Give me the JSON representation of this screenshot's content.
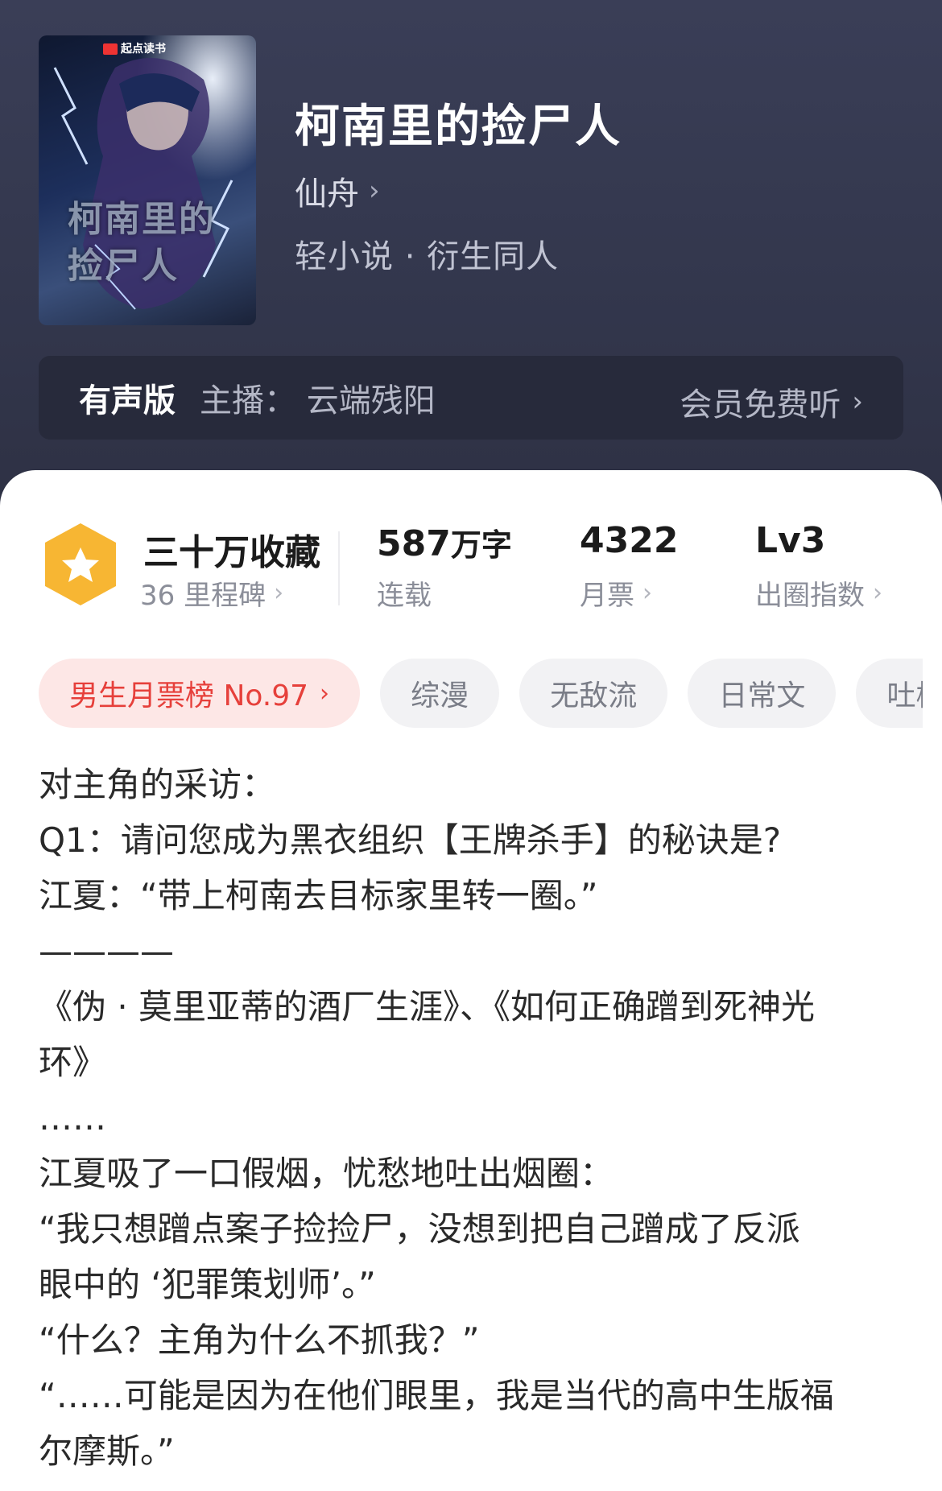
{
  "cover": {
    "brand": "起点读书",
    "title_text": "柯南里的捡尸人"
  },
  "book": {
    "title": "柯南里的捡尸人",
    "author": "仙舟",
    "genre": "轻小说 · 衍生同人"
  },
  "audio": {
    "tag": "有声版",
    "host": "主播： 云端残阳",
    "action": "会员免费听"
  },
  "stats": {
    "favorites": "三十万收藏",
    "milestones": "36 里程碑",
    "words_value": "587",
    "words_unit": "万字",
    "status": "连载",
    "votes_value": "4322",
    "votes_label": "月票",
    "level_value": "Lv3",
    "level_label": "出圈指数"
  },
  "tags": [
    "男生月票榜 No.97",
    "综漫",
    "无敌流",
    "日常文",
    "吐槽"
  ],
  "description": [
    "对主角的采访：",
    "Q1：请问您成为黑衣组织【王牌杀手】的秘诀是?",
    "江夏：“带上柯南去目标家里转一圈。”",
    "————",
    "《伪 · 莫里亚蒂的酒厂生涯》、《如何正确蹭到死神光",
    "环》",
    "……",
    "江夏吸了一口假烟，忧愁地吐出烟圈：",
    "“我只想蹭点案子捡捡尸，没想到把自己蹭成了反派",
    "眼中的 ‘犯罪策划师’。”",
    "“什么？主角为什么不抓我？”",
    "“……可能是因为在他们眼里，我是当代的高中生版福",
    "尔摩斯。”"
  ],
  "colors": {
    "header_bg": "#33374d",
    "audio_bar_bg": "#272a3b",
    "hot_tag_bg": "#fde7e6",
    "hot_tag_text": "#e6403b",
    "medal": "#f7b633"
  }
}
